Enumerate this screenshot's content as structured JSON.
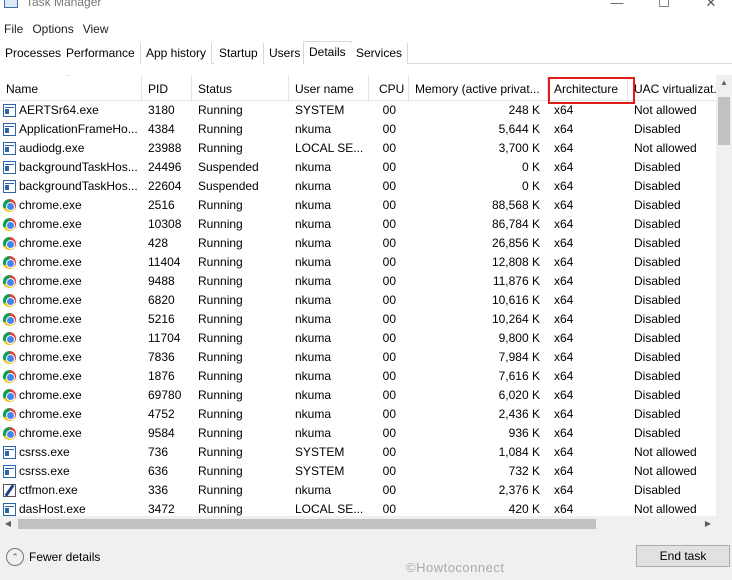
{
  "window": {
    "title": "Task Manager",
    "minimize_glyph": "—",
    "maximize_glyph": "☐",
    "close_glyph": "✕"
  },
  "menu": [
    "File",
    "Options",
    "View"
  ],
  "tabs": [
    "Processes",
    "Performance",
    "App history",
    "Startup",
    "Users",
    "Details",
    "Services"
  ],
  "active_tab": "Details",
  "columns": {
    "name": "Name",
    "pid": "PID",
    "status": "Status",
    "user": "User name",
    "cpu": "CPU",
    "memory": "Memory (active privat...",
    "architecture": "Architecture",
    "uac": "UAC virtualizat..."
  },
  "highlighted_column": "architecture",
  "highlight_color": "#e21b1b",
  "rows": [
    {
      "icon": "win",
      "name": "AERTSr64.exe",
      "pid": "3180",
      "status": "Running",
      "user": "SYSTEM",
      "cpu": "00",
      "memory": "248 K",
      "arch": "x64",
      "uac": "Not allowed"
    },
    {
      "icon": "win",
      "name": "ApplicationFrameHo...",
      "pid": "4384",
      "status": "Running",
      "user": "nkuma",
      "cpu": "00",
      "memory": "5,644 K",
      "arch": "x64",
      "uac": "Disabled"
    },
    {
      "icon": "win",
      "name": "audiodg.exe",
      "pid": "23988",
      "status": "Running",
      "user": "LOCAL SE...",
      "cpu": "00",
      "memory": "3,700 K",
      "arch": "x64",
      "uac": "Not allowed"
    },
    {
      "icon": "win",
      "name": "backgroundTaskHos...",
      "pid": "24496",
      "status": "Suspended",
      "user": "nkuma",
      "cpu": "00",
      "memory": "0 K",
      "arch": "x64",
      "uac": "Disabled"
    },
    {
      "icon": "win",
      "name": "backgroundTaskHos...",
      "pid": "22604",
      "status": "Suspended",
      "user": "nkuma",
      "cpu": "00",
      "memory": "0 K",
      "arch": "x64",
      "uac": "Disabled"
    },
    {
      "icon": "chrome",
      "name": "chrome.exe",
      "pid": "2516",
      "status": "Running",
      "user": "nkuma",
      "cpu": "00",
      "memory": "88,568 K",
      "arch": "x64",
      "uac": "Disabled"
    },
    {
      "icon": "chrome",
      "name": "chrome.exe",
      "pid": "10308",
      "status": "Running",
      "user": "nkuma",
      "cpu": "00",
      "memory": "86,784 K",
      "arch": "x64",
      "uac": "Disabled"
    },
    {
      "icon": "chrome",
      "name": "chrome.exe",
      "pid": "428",
      "status": "Running",
      "user": "nkuma",
      "cpu": "00",
      "memory": "26,856 K",
      "arch": "x64",
      "uac": "Disabled"
    },
    {
      "icon": "chrome",
      "name": "chrome.exe",
      "pid": "11404",
      "status": "Running",
      "user": "nkuma",
      "cpu": "00",
      "memory": "12,808 K",
      "arch": "x64",
      "uac": "Disabled"
    },
    {
      "icon": "chrome",
      "name": "chrome.exe",
      "pid": "9488",
      "status": "Running",
      "user": "nkuma",
      "cpu": "00",
      "memory": "11,876 K",
      "arch": "x64",
      "uac": "Disabled"
    },
    {
      "icon": "chrome",
      "name": "chrome.exe",
      "pid": "6820",
      "status": "Running",
      "user": "nkuma",
      "cpu": "00",
      "memory": "10,616 K",
      "arch": "x64",
      "uac": "Disabled"
    },
    {
      "icon": "chrome",
      "name": "chrome.exe",
      "pid": "5216",
      "status": "Running",
      "user": "nkuma",
      "cpu": "00",
      "memory": "10,264 K",
      "arch": "x64",
      "uac": "Disabled"
    },
    {
      "icon": "chrome",
      "name": "chrome.exe",
      "pid": "11704",
      "status": "Running",
      "user": "nkuma",
      "cpu": "00",
      "memory": "9,800 K",
      "arch": "x64",
      "uac": "Disabled"
    },
    {
      "icon": "chrome",
      "name": "chrome.exe",
      "pid": "7836",
      "status": "Running",
      "user": "nkuma",
      "cpu": "00",
      "memory": "7,984 K",
      "arch": "x64",
      "uac": "Disabled"
    },
    {
      "icon": "chrome",
      "name": "chrome.exe",
      "pid": "1876",
      "status": "Running",
      "user": "nkuma",
      "cpu": "00",
      "memory": "7,616 K",
      "arch": "x64",
      "uac": "Disabled"
    },
    {
      "icon": "chrome",
      "name": "chrome.exe",
      "pid": "69780",
      "status": "Running",
      "user": "nkuma",
      "cpu": "00",
      "memory": "6,020 K",
      "arch": "x64",
      "uac": "Disabled"
    },
    {
      "icon": "chrome",
      "name": "chrome.exe",
      "pid": "4752",
      "status": "Running",
      "user": "nkuma",
      "cpu": "00",
      "memory": "2,436 K",
      "arch": "x64",
      "uac": "Disabled"
    },
    {
      "icon": "chrome",
      "name": "chrome.exe",
      "pid": "9584",
      "status": "Running",
      "user": "nkuma",
      "cpu": "00",
      "memory": "936 K",
      "arch": "x64",
      "uac": "Disabled"
    },
    {
      "icon": "win",
      "name": "csrss.exe",
      "pid": "736",
      "status": "Running",
      "user": "SYSTEM",
      "cpu": "00",
      "memory": "1,084 K",
      "arch": "x64",
      "uac": "Not allowed"
    },
    {
      "icon": "win",
      "name": "csrss.exe",
      "pid": "636",
      "status": "Running",
      "user": "SYSTEM",
      "cpu": "00",
      "memory": "732 K",
      "arch": "x64",
      "uac": "Not allowed"
    },
    {
      "icon": "pen",
      "name": "ctfmon.exe",
      "pid": "336",
      "status": "Running",
      "user": "nkuma",
      "cpu": "00",
      "memory": "2,376 K",
      "arch": "x64",
      "uac": "Disabled"
    },
    {
      "icon": "win",
      "name": "dasHost.exe",
      "pid": "3472",
      "status": "Running",
      "user": "LOCAL SE...",
      "cpu": "00",
      "memory": "420 K",
      "arch": "x64",
      "uac": "Not allowed"
    }
  ],
  "scroll": {
    "up_glyph": "▲",
    "left_glyph": "◀",
    "right_glyph": "▶",
    "sort_glyph": "⌃"
  },
  "footer": {
    "fewer_details_label": "Fewer details",
    "fewer_details_glyph": "⌃",
    "end_task_label": "End task"
  },
  "watermark": "©Howtoconnect"
}
